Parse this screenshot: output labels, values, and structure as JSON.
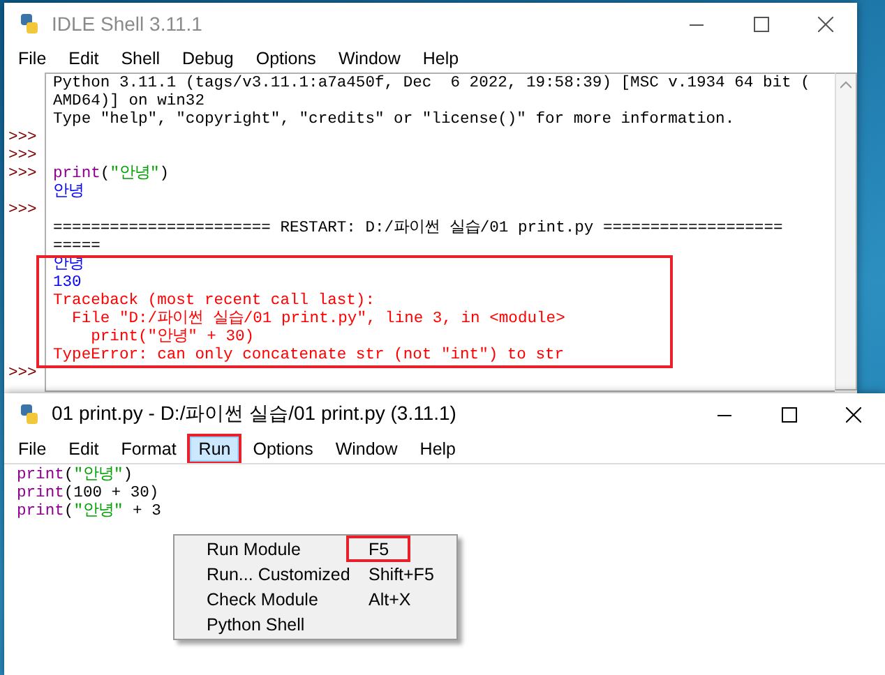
{
  "shell": {
    "title": "IDLE Shell 3.11.1",
    "active": false,
    "menu": [
      {
        "label": "File",
        "selected": false
      },
      {
        "label": "Edit",
        "selected": false
      },
      {
        "label": "Shell",
        "selected": false
      },
      {
        "label": "Debug",
        "selected": false
      },
      {
        "label": "Options",
        "selected": false
      },
      {
        "label": "Window",
        "selected": false
      },
      {
        "label": "Help",
        "selected": false
      }
    ],
    "lines": [
      {
        "highlighted": false,
        "segments": [
          {
            "kind": "plain",
            "text": "Python 3.11.1 (tags/v3.11.1:a7a450f, Dec  6 2022, 19:58:39) [MSC v.1934 64 bit ("
          }
        ]
      },
      {
        "highlighted": false,
        "segments": [
          {
            "kind": "plain",
            "text": "AMD64)] on win32"
          }
        ]
      },
      {
        "highlighted": false,
        "segments": [
          {
            "kind": "plain",
            "text": "Type \"help\", \"copyright\", \"credits\" or \"license()\" for more information."
          }
        ]
      },
      {
        "highlighted": false,
        "prompt": ">>>"
      },
      {
        "highlighted": false,
        "prompt": ">>>"
      },
      {
        "highlighted": false,
        "prompt": ">>>",
        "segments": [
          {
            "kind": "builtin",
            "text": "print"
          },
          {
            "kind": "plain",
            "text": "("
          },
          {
            "kind": "string",
            "text": "\"안녕\""
          },
          {
            "kind": "plain",
            "text": ")"
          }
        ]
      },
      {
        "highlighted": false,
        "segments": [
          {
            "kind": "output",
            "text": "안녕"
          }
        ]
      },
      {
        "highlighted": false,
        "prompt": ">>>"
      },
      {
        "highlighted": false,
        "segments": [
          {
            "kind": "plain",
            "text": "======================= RESTART: D:/파이썬 실습/01 print.py ==================="
          }
        ]
      },
      {
        "highlighted": false,
        "segments": [
          {
            "kind": "plain",
            "text": "====="
          }
        ]
      },
      {
        "highlighted": true,
        "segments": [
          {
            "kind": "output",
            "text": "안녕"
          }
        ]
      },
      {
        "highlighted": true,
        "segments": [
          {
            "kind": "output",
            "text": "130"
          }
        ]
      },
      {
        "highlighted": true,
        "segments": [
          {
            "kind": "error",
            "text": "Traceback (most recent call last):"
          }
        ]
      },
      {
        "highlighted": true,
        "segments": [
          {
            "kind": "error",
            "text": "  File \"D:/파이썬 실습/01 print.py\", line 3, in <module>"
          }
        ]
      },
      {
        "highlighted": true,
        "segments": [
          {
            "kind": "error",
            "text": "    print(\"안녕\" + 30)"
          }
        ]
      },
      {
        "highlighted": true,
        "segments": [
          {
            "kind": "error",
            "text": "TypeError: can only concatenate str (not \"int\") to str"
          }
        ]
      },
      {
        "highlighted": false,
        "prompt": ">>>"
      }
    ]
  },
  "editor": {
    "title": "01 print.py - D:/파이썬 실습/01 print.py (3.11.1)",
    "active": true,
    "menu": [
      {
        "label": "File",
        "selected": false,
        "highlighted": false
      },
      {
        "label": "Edit",
        "selected": false,
        "highlighted": false
      },
      {
        "label": "Format",
        "selected": false,
        "highlighted": false
      },
      {
        "label": "Run",
        "selected": true,
        "highlighted": true
      },
      {
        "label": "Options",
        "selected": false,
        "highlighted": false
      },
      {
        "label": "Window",
        "selected": false,
        "highlighted": false
      },
      {
        "label": "Help",
        "selected": false,
        "highlighted": false
      }
    ],
    "lines": [
      {
        "segments": [
          {
            "kind": "builtin",
            "text": "print"
          },
          {
            "kind": "plain",
            "text": "("
          },
          {
            "kind": "string",
            "text": "\"안녕\""
          },
          {
            "kind": "plain",
            "text": ")"
          }
        ]
      },
      {
        "segments": [
          {
            "kind": "builtin",
            "text": "print"
          },
          {
            "kind": "plain",
            "text": "(100 + 30)"
          }
        ]
      },
      {
        "segments": [
          {
            "kind": "builtin",
            "text": "print"
          },
          {
            "kind": "plain",
            "text": "("
          },
          {
            "kind": "string",
            "text": "\"안녕\""
          },
          {
            "kind": "plain",
            "text": " + 3"
          }
        ]
      }
    ],
    "dropdown": [
      {
        "label": "Run Module",
        "shortcut": "F5",
        "highlighted": true
      },
      {
        "label": "Run... Customized",
        "shortcut": "Shift+F5",
        "highlighted": false
      },
      {
        "label": "Check Module",
        "shortcut": "Alt+X",
        "highlighted": false
      },
      {
        "label": "Python Shell",
        "highlighted": false
      }
    ]
  }
}
